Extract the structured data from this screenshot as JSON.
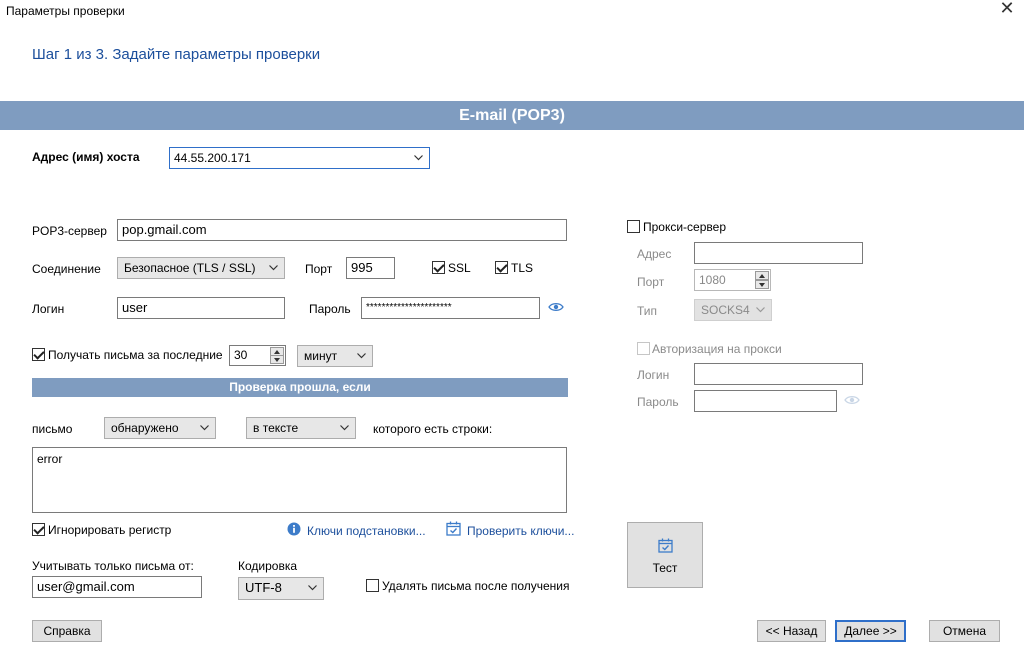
{
  "window": {
    "title": "Параметры проверки",
    "close_glyph": "✕"
  },
  "step_title": "Шаг 1 из 3. Задайте параметры проверки",
  "section_title": "E-mail (POP3)",
  "host": {
    "label": "Адрес (имя) хоста",
    "value": "44.55.200.171"
  },
  "pop3": {
    "server_label": "POP3-сервер",
    "server_value": "pop.gmail.com",
    "connection_label": "Соединение",
    "connection_value": "Безопасное (TLS / SSL)",
    "port_label": "Порт",
    "port_value": "995",
    "ssl_label": "SSL",
    "ssl_checked": true,
    "tls_label": "TLS",
    "tls_checked": true,
    "login_label": "Логин",
    "login_value": "user",
    "password_label": "Пароль",
    "password_value": "**********************",
    "eye_icon": "eye-icon"
  },
  "receive": {
    "label": "Получать письма за последние",
    "checked": true,
    "count": "30",
    "unit": "минут"
  },
  "check_band": "Проверка прошла, если",
  "condition": {
    "letter_label": "письмо",
    "found_value": "обнаружено",
    "where_value": "в тексте",
    "suffix_label": "которого есть строки:",
    "strings_value": "error"
  },
  "ignore_case": {
    "label": "Игнорировать регистр",
    "checked": true
  },
  "links": {
    "keys": "Ключи подстановки...",
    "check_keys": "Проверить ключи..."
  },
  "from_filter": {
    "label": "Учитывать только письма от:",
    "value": "user@gmail.com"
  },
  "encoding": {
    "label": "Кодировка",
    "value": "UTF-8"
  },
  "delete_after": {
    "label": "Удалять письма после получения",
    "checked": false
  },
  "proxy": {
    "enable_label": "Прокси-сервер",
    "enabled": false,
    "address_label": "Адрес",
    "address_value": "",
    "port_label": "Порт",
    "port_value": "1080",
    "type_label": "Тип",
    "type_value": "SOCKS4",
    "auth_label": "Авторизация на прокси",
    "auth_checked": false,
    "login_label": "Логин",
    "login_value": "",
    "password_label": "Пароль",
    "password_value": ""
  },
  "test_button": "Тест",
  "buttons": {
    "help": "Справка",
    "back": "<< Назад",
    "next": "Далее >>",
    "cancel": "Отмена"
  },
  "colors": {
    "band": "#7f9cc0",
    "link": "#1c4f9c",
    "focus": "#2f6fc9"
  }
}
